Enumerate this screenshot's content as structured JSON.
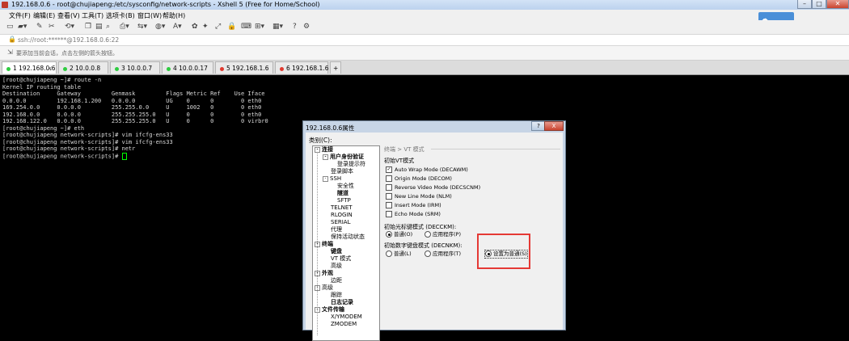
{
  "window": {
    "title": "192.168.0.6 - root@chujiapeng:/etc/sysconfig/network-scripts - Xshell 5 (Free for Home/School)"
  },
  "menu": [
    "文件(F)",
    "编辑(E)",
    "查看(V)",
    "工具(T)",
    "选项卡(B)",
    "窗口(W)",
    "帮助(H)"
  ],
  "cloud_button": "",
  "address": "ssh://root:******@192.168.0.6:22",
  "hint": "要添加当前会话，点击左侧的箭头按钮。",
  "tabs": [
    {
      "label": "1 192.168.0.6",
      "color": "#2ecc40",
      "active": true
    },
    {
      "label": "2 10.0.0.8",
      "color": "#2ecc40"
    },
    {
      "label": "3 10.0.0.7",
      "color": "#2ecc40"
    },
    {
      "label": "4 10.0.0.17",
      "color": "#2ecc40"
    },
    {
      "label": "5 192.168.1.6",
      "color": "#e03a2f"
    },
    {
      "label": "6 192.168.1.6",
      "color": "#e03a2f"
    }
  ],
  "tab_add": "+",
  "terminal": {
    "lines": [
      "[root@chujiapeng ~]# route -n",
      "Kernel IP routing table",
      "Destination     Gateway         Genmask         Flags Metric Ref    Use Iface",
      "0.0.0.0         192.168.1.200   0.0.0.0         UG    0      0        0 eth0",
      "169.254.0.0     0.0.0.0         255.255.0.0     U     1002   0        0 eth0",
      "192.168.0.0     0.0.0.0         255.255.255.0   U     0      0        0 eth0",
      "192.168.122.0   0.0.0.0         255.255.255.0   U     0      0        0 virbr0",
      "[root@chujiapeng ~]# eth",
      "[root@chujiapeng network-scripts]# vim ifcfg-ens33",
      "[root@chujiapeng network-scripts]# vim ifcfg-ens33",
      "[root@chujiapeng network-scripts]# netr",
      "[root@chujiapeng network-scripts]# "
    ]
  },
  "dialog": {
    "title": "192.168.0.6属性",
    "help": "?",
    "close": "X",
    "category_label": "类别(C):",
    "tree": [
      {
        "label": "连接",
        "bold": true,
        "level": 0,
        "box": "-"
      },
      {
        "label": "用户身份验证",
        "bold": true,
        "level": 1,
        "box": "-"
      },
      {
        "label": "登录提示符",
        "bold": false,
        "level": 2
      },
      {
        "label": "登录脚本",
        "bold": false,
        "level": 1
      },
      {
        "label": "SSH",
        "bold": false,
        "level": 1,
        "box": "-"
      },
      {
        "label": "安全性",
        "bold": false,
        "level": 2
      },
      {
        "label": "隧道",
        "bold": true,
        "level": 2
      },
      {
        "label": "SFTP",
        "bold": false,
        "level": 2
      },
      {
        "label": "TELNET",
        "bold": false,
        "level": 1
      },
      {
        "label": "RLOGIN",
        "bold": false,
        "level": 1
      },
      {
        "label": "SERIAL",
        "bold": false,
        "level": 1
      },
      {
        "label": "代理",
        "bold": false,
        "level": 1
      },
      {
        "label": "保持活动状态",
        "bold": false,
        "level": 1
      },
      {
        "label": "终端",
        "bold": true,
        "level": 0,
        "box": "-"
      },
      {
        "label": "键盘",
        "bold": true,
        "level": 1
      },
      {
        "label": "VT 模式",
        "bold": false,
        "level": 1
      },
      {
        "label": "高级",
        "bold": false,
        "level": 1
      },
      {
        "label": "外观",
        "bold": true,
        "level": 0,
        "box": "-"
      },
      {
        "label": "边距",
        "bold": false,
        "level": 1
      },
      {
        "label": "高级",
        "bold": false,
        "level": 0,
        "box": "-"
      },
      {
        "label": "跟踪",
        "bold": false,
        "level": 1
      },
      {
        "label": "日志记录",
        "bold": true,
        "level": 1
      },
      {
        "label": "文件传输",
        "bold": true,
        "level": 0,
        "box": "-"
      },
      {
        "label": "X/YMODEM",
        "bold": false,
        "level": 1
      },
      {
        "label": "ZMODEM",
        "bold": false,
        "level": 1
      }
    ],
    "breadcrumb": "终端 > VT 模式",
    "init_vt_label": "初始VT模式",
    "checkboxes": [
      {
        "label": "Auto Wrap Mode (DECAWM)",
        "checked": true
      },
      {
        "label": "Origin Mode (DECOM)",
        "checked": false
      },
      {
        "label": "Reverse Video Mode (DECSCNM)",
        "checked": false
      },
      {
        "label": "New Line Mode (NLM)",
        "checked": false
      },
      {
        "label": "Insert Mode (IRM)",
        "checked": false
      },
      {
        "label": "Echo Mode (SRM)",
        "checked": false
      }
    ],
    "cursor_keys_label": "初始光标键模式 (DECCKM):",
    "cursor_normal": "普通(O)",
    "cursor_app": "应用程序(P)",
    "keypad_label": "初始数字键盘模式 (DECNKM):",
    "keypad_normal": "普通(L)",
    "keypad_app": "应用程序(T)",
    "keypad_set_normal": "设置为普通(S)"
  }
}
